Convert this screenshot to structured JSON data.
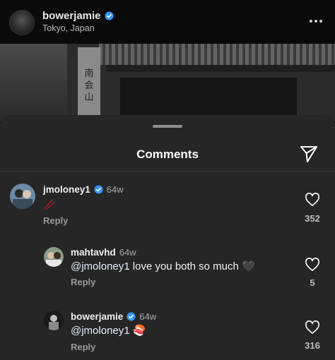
{
  "post": {
    "username": "bowerjamie",
    "location": "Tokyo, Japan",
    "verified": true,
    "photo_sign_text": "南会山"
  },
  "sheet": {
    "title": "Comments"
  },
  "comments": [
    {
      "username": "jmoloney1",
      "verified": true,
      "time": "64w",
      "text": "🥢",
      "reply_label": "Reply",
      "likes": "352",
      "avatar_icon": "avatar-photo-icon"
    },
    {
      "username": "mahtavhd",
      "verified": false,
      "time": "64w",
      "mention": "@jmoloney1",
      "text": " love you both so much 🖤",
      "reply_label": "Reply",
      "likes": "5",
      "avatar_icon": "avatar-photo-icon"
    },
    {
      "username": "bowerjamie",
      "verified": true,
      "time": "64w",
      "mention": "@jmoloney1",
      "text": " 🍣",
      "reply_label": "Reply",
      "likes": "316",
      "avatar_icon": "avatar-photo-icon"
    }
  ],
  "colors": {
    "sheet_bg": "#262626",
    "verified_blue": "#3897f0",
    "muted_text": "#a8a8a8"
  }
}
